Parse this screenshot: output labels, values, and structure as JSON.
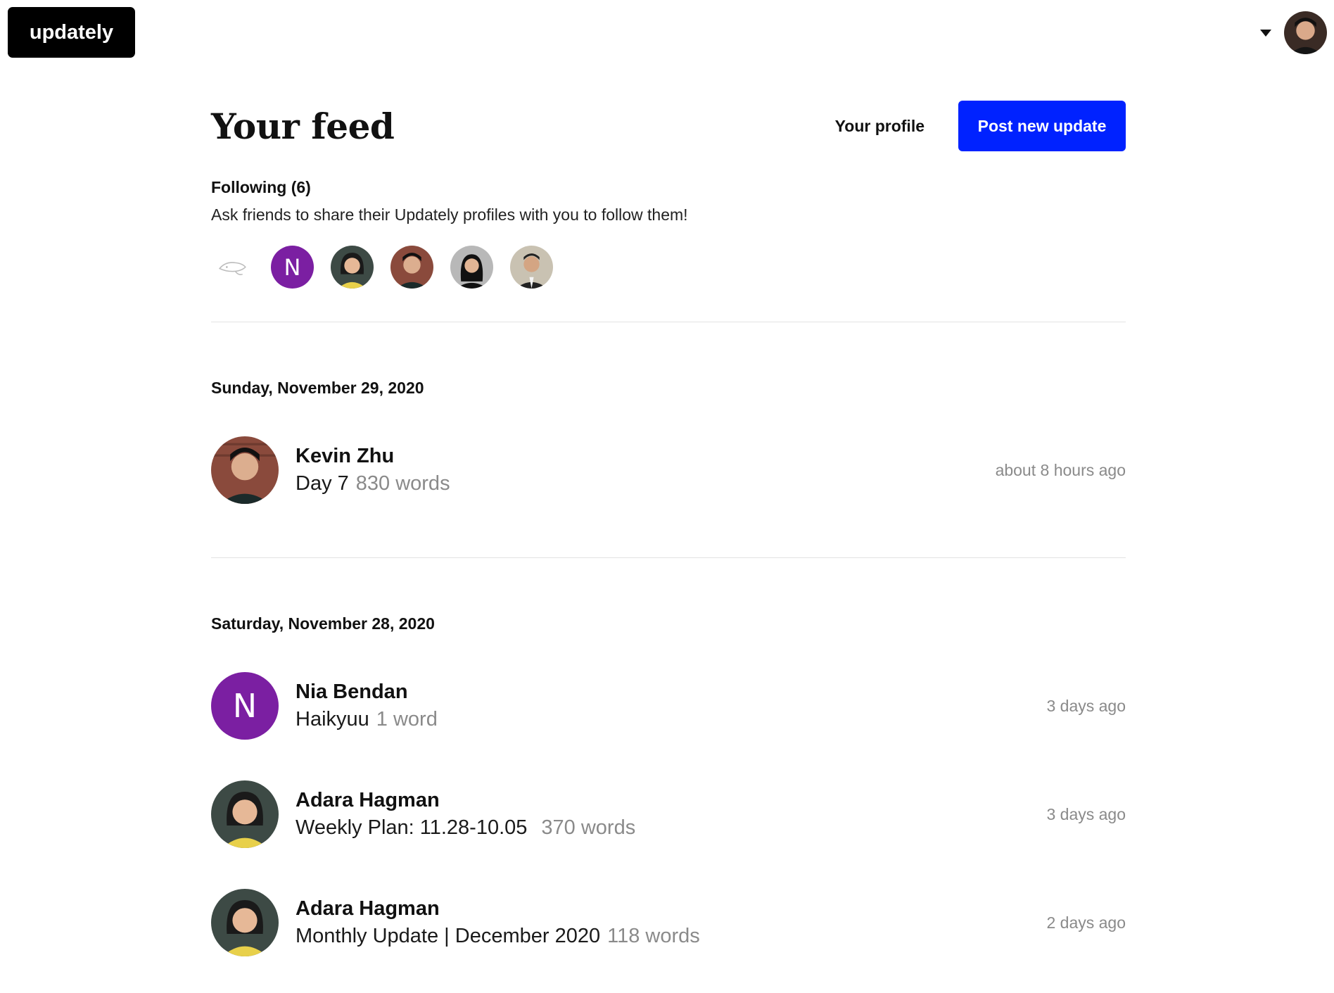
{
  "app": {
    "logo_text": "updately"
  },
  "header": {
    "title": "Your feed",
    "profile_link": "Your profile",
    "post_button": "Post new update"
  },
  "following": {
    "title": "Following (6)",
    "hint": "Ask friends to share their Updately profiles with you to follow them!",
    "avatars": [
      {
        "kind": "sketch-icon"
      },
      {
        "kind": "letter",
        "letter": "N",
        "color": "#7b1fa2"
      },
      {
        "kind": "photo",
        "person": "adara"
      },
      {
        "kind": "photo",
        "person": "kevin"
      },
      {
        "kind": "photo",
        "person": "woman-dark-hair"
      },
      {
        "kind": "photo",
        "person": "man-suit"
      }
    ]
  },
  "feed": {
    "groups": [
      {
        "date": "Sunday, November 29, 2020",
        "updates": [
          {
            "name": "Kevin Zhu",
            "title": "Day 7",
            "words": "830 words",
            "time": "about 8 hours ago",
            "avatar": "kevin"
          }
        ]
      },
      {
        "date": "Saturday, November 28, 2020",
        "updates": [
          {
            "name": "Nia Bendan",
            "title": "Haikyuu",
            "words": "1 word",
            "time": "3 days ago",
            "avatar": "letter-N"
          },
          {
            "name": "Adara Hagman",
            "title": "Weekly Plan: 11.28-10.05",
            "words": "370 words",
            "time": "3 days ago",
            "avatar": "adara"
          },
          {
            "name": "Adara Hagman",
            "title": "Monthly Update | December 2020",
            "words": "118 words",
            "time": "2 days ago",
            "avatar": "adara"
          }
        ]
      }
    ]
  },
  "colors": {
    "primary_button": "#0022ff",
    "letter_avatar": "#7b1fa2",
    "muted_text": "#8a8a8a"
  }
}
